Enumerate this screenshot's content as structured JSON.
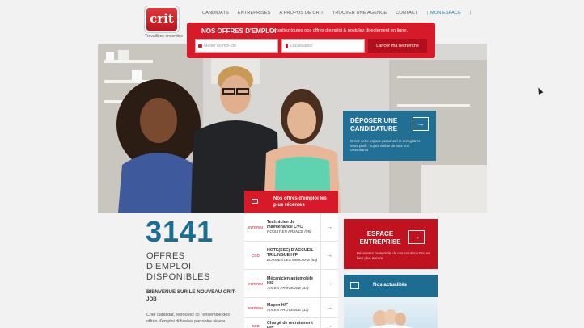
{
  "brand": {
    "logo_text": "crit",
    "tagline": "Travaillons ensemble"
  },
  "nav": {
    "items": [
      "CANDIDATS",
      "ENTREPRISES",
      "A PROPOS DE CRIT",
      "TROUVER UNE AGENCE",
      "CONTACT"
    ],
    "espace": "MON ESPACE"
  },
  "search": {
    "title": "NOS OFFRES D'EMPLOI",
    "subtitle": "Consultez toutes nos offres d'emploi & postulez directement en ligne.",
    "job_placeholder": "Métier ou mot-clé",
    "location_placeholder": "Localisation",
    "button": "Lancer ma recherche"
  },
  "deposit": {
    "title": "DÉPOSER UNE CANDIDATURE",
    "desc": "Créez votre espace personnel et enregistrez votre profil : soyez visible de tous nos consultants"
  },
  "jobs": {
    "header": "Nos offres d'emploi les plus récentes",
    "items": [
      {
        "type": "INTÉRIM",
        "title": "Technicien de maintenance CVC",
        "location": "ROISSY EN FRANCE (95)"
      },
      {
        "type": "CDD",
        "title": "HOTE(SSE) D'ACCUEIL TRILINGUE H/F",
        "location": "BORMES LES MIMOSAS (83)"
      },
      {
        "type": "INTÉRIM",
        "title": "Mécanicien automobile H/F",
        "location": "AIX EN PROVENCE (13)"
      },
      {
        "type": "INTÉRIM",
        "title": "Maçon H/F",
        "location": "AIX EN PROVENCE (13)"
      },
      {
        "type": "CDD",
        "title": "Chargé de recrutement H/F",
        "location": ""
      }
    ]
  },
  "counter": {
    "number": "3141",
    "label_1": "OFFRES",
    "label_2": "D'EMPLOI",
    "label_3": "DISPONIBLES",
    "welcome": "BIENVENUE SUR LE NOUVEAU CRIT-JOB !",
    "intro": "Cher candidat, retrouvez ici l'ensemble des offres d'emploi diffusées par notre réseau"
  },
  "entreprise": {
    "title": "ESPACE ENTREPRISE",
    "desc": "Découvrez l'ensemble de nos solutions RH, et bien plus encore"
  },
  "news": {
    "title": "Nos actualités"
  },
  "colors": {
    "red": "#d71a2a",
    "blue": "#1d6d93",
    "dark_red": "#c0121f"
  }
}
